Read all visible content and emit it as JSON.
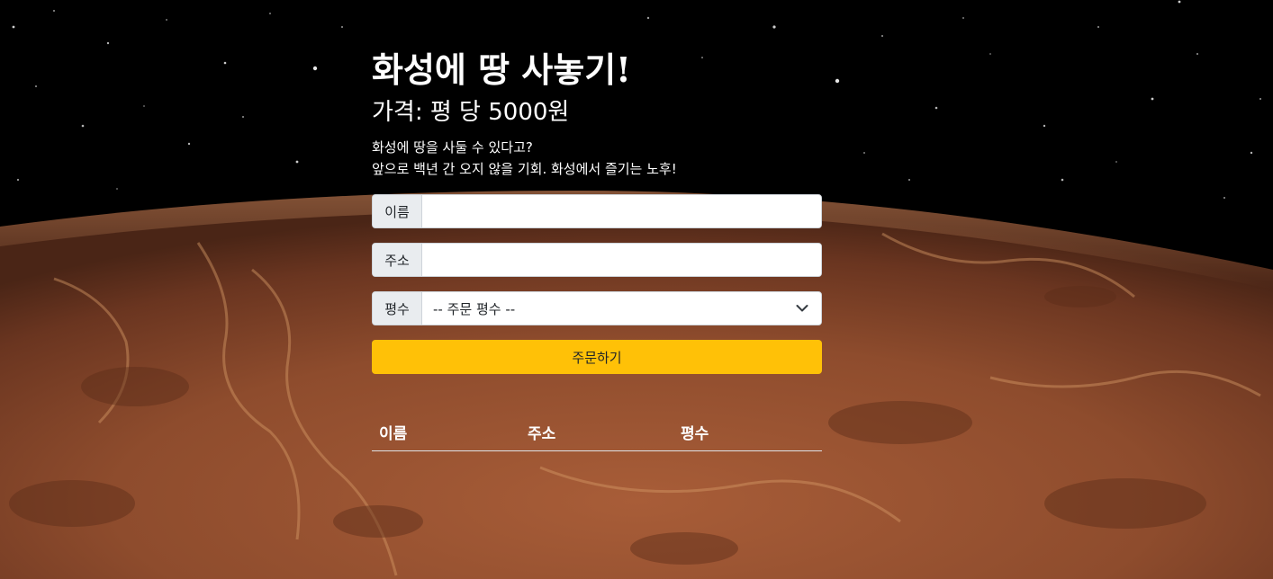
{
  "page": {
    "title": "화성에 땅 사놓기!",
    "price": "가격: 평 당 5000원",
    "description": [
      "화성에 땅을 사둘 수 있다고?",
      "앞으로 백년 간 오지 않을 기회. 화성에서 즐기는 노후!"
    ]
  },
  "form": {
    "name": {
      "label": "이름",
      "value": ""
    },
    "address": {
      "label": "주소",
      "value": ""
    },
    "size": {
      "label": "평수",
      "selected": "-- 주문 평수 --"
    },
    "submit_label": "주문하기"
  },
  "table": {
    "headers": [
      "이름",
      "주소",
      "평수"
    ]
  },
  "colors": {
    "accent": "#ffc107",
    "background_space": "#000000",
    "mars_surface": "#8a4a2c"
  },
  "icons": {
    "select_arrow": "chevron-down-icon"
  }
}
